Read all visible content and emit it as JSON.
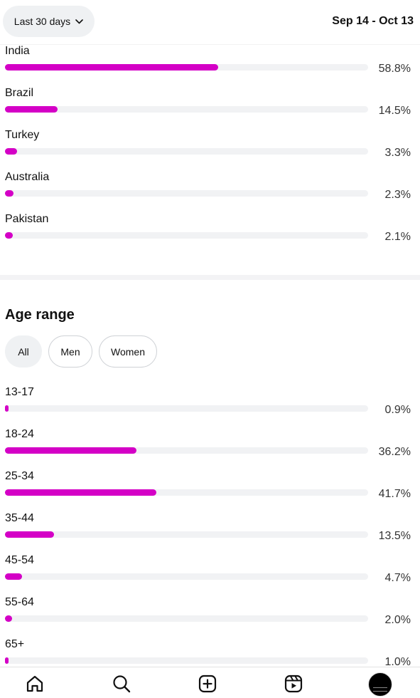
{
  "header": {
    "range_label": "Last 30 days",
    "date_range": "Sep 14 - Oct 13"
  },
  "colors": {
    "bar_fill": "#d400c6",
    "bar_track": "#f1f2f4"
  },
  "countries": [
    {
      "label": "India",
      "pct": "58.8%",
      "value": 58.8
    },
    {
      "label": "Brazil",
      "pct": "14.5%",
      "value": 14.5
    },
    {
      "label": "Turkey",
      "pct": "3.3%",
      "value": 3.3
    },
    {
      "label": "Australia",
      "pct": "2.3%",
      "value": 2.3
    },
    {
      "label": "Pakistan",
      "pct": "2.1%",
      "value": 2.1
    }
  ],
  "age_section": {
    "title": "Age range",
    "filters": [
      "All",
      "Men",
      "Women"
    ],
    "selected_filter": "All",
    "ranges": [
      {
        "label": "13-17",
        "pct": "0.9%",
        "value": 0.9
      },
      {
        "label": "18-24",
        "pct": "36.2%",
        "value": 36.2
      },
      {
        "label": "25-34",
        "pct": "41.7%",
        "value": 41.7
      },
      {
        "label": "35-44",
        "pct": "13.5%",
        "value": 13.5
      },
      {
        "label": "45-54",
        "pct": "4.7%",
        "value": 4.7
      },
      {
        "label": "55-64",
        "pct": "2.0%",
        "value": 2.0
      },
      {
        "label": "65+",
        "pct": "1.0%",
        "value": 1.0
      }
    ]
  },
  "nav": {
    "items": [
      {
        "icon": "home-icon"
      },
      {
        "icon": "search-icon"
      },
      {
        "icon": "create-icon"
      },
      {
        "icon": "reels-icon"
      },
      {
        "icon": "profile-avatar"
      }
    ]
  }
}
